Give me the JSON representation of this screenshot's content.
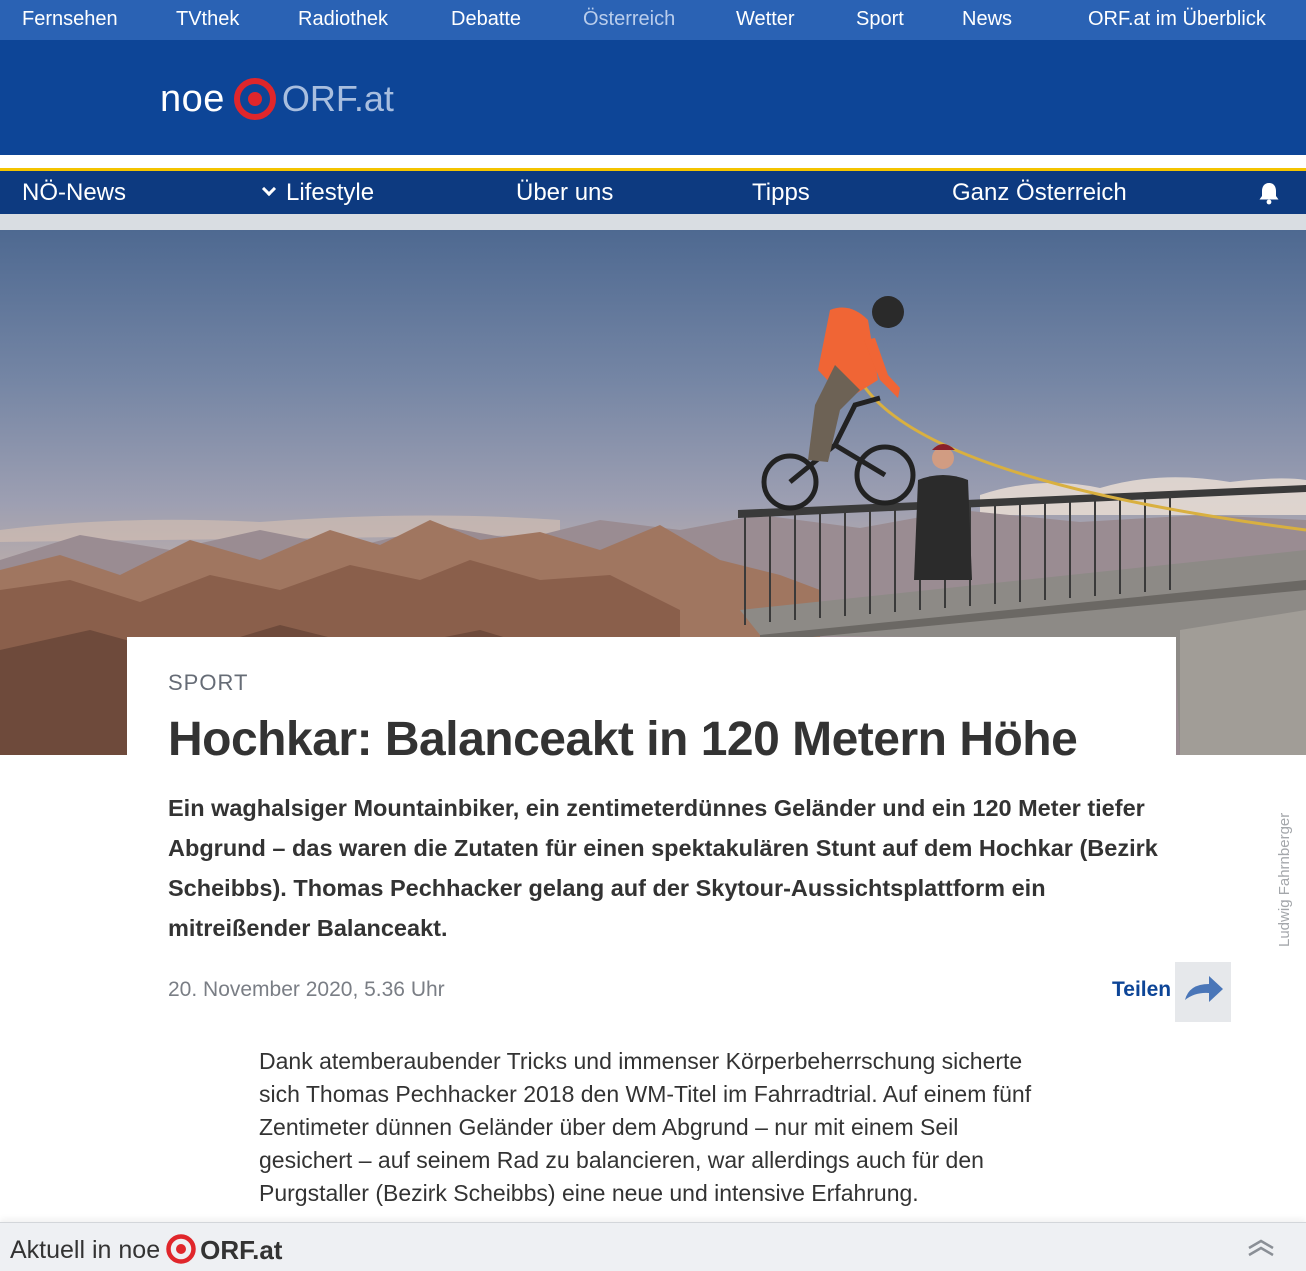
{
  "topnav": {
    "items": [
      "Fernsehen",
      "TVthek",
      "Radiothek",
      "Debatte",
      "Österreich",
      "Wetter",
      "Sport",
      "News",
      "ORF.at im Überblick"
    ],
    "active": "Österreich"
  },
  "logo": {
    "region": "noe",
    "brand": "ORF.at"
  },
  "mainnav": {
    "items": [
      "NÖ-News",
      "Lifestyle",
      "Über uns",
      "Tipps",
      "Ganz Österreich"
    ]
  },
  "article": {
    "kicker": "SPORT",
    "title": "Hochkar: Balanceakt in 120 Metern Höhe",
    "lead": "Ein waghalsiger Mountainbiker, ein zentimeterdünnes Geländer und ein 120 Meter tiefer Abgrund – das waren die Zutaten für einen spektakulären Stunt auf dem Hochkar (Bezirk Scheibbs). Thomas Pechhacker gelang auf der Skytour-Aussichtsplattform ein mitreißender Balanceakt.",
    "photo_credit": "Ludwig Fahrnberger",
    "date": "20. November 2020, 5.36 Uhr",
    "share_label": "Teilen",
    "body": "Dank atemberaubender Tricks und immenser Körperbeherrschung sicherte sich Thomas Pechhacker 2018 den WM-Titel im Fahrradtrial. Auf einem fünf Zentimeter dünnen Geländer über dem Abgrund – nur mit einem Seil gesichert – auf seinem Rad zu balancieren, war allerdings auch für den Purgstaller (Bezirk Scheibbs) eine neue und intensive Erfahrung."
  },
  "footer": {
    "label": "Aktuell in noe",
    "brand": "ORF.at"
  },
  "colors": {
    "topbar": "#2a62b4",
    "header": "#0d4597",
    "nav": "#0d3a80",
    "accent_yellow": "#f4c400",
    "orf_red": "#e0262b"
  }
}
